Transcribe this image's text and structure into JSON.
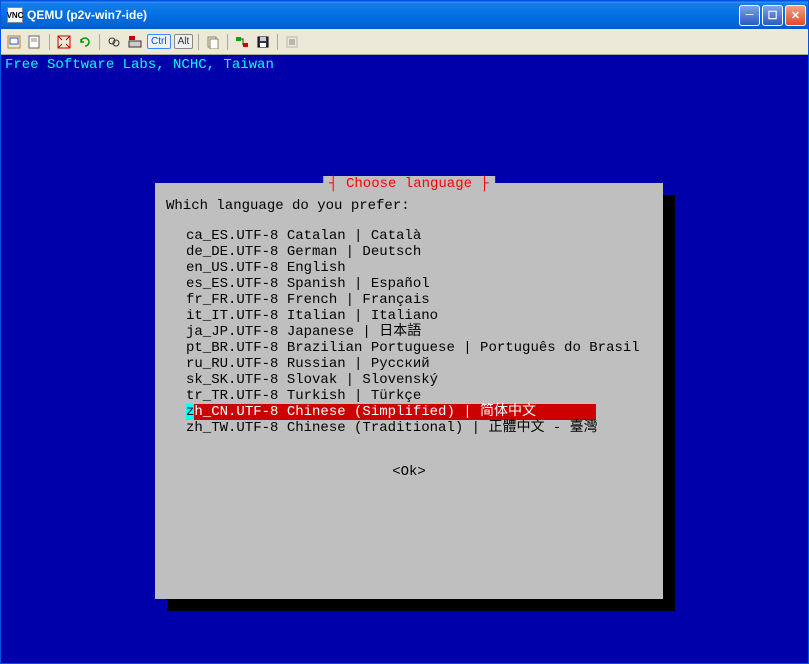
{
  "window": {
    "title": "QEMU (p2v-win7-ide)",
    "icon_text": "VNC"
  },
  "toolbar": {
    "ctrl": "Ctrl",
    "alt": "Alt"
  },
  "console": {
    "header": "Free Software Labs, NCHC, Taiwan"
  },
  "dialog": {
    "title": "Choose language",
    "prompt": "Which language do you prefer:",
    "ok": "<Ok>",
    "selected_index": 11,
    "languages": [
      "ca_ES.UTF-8 Catalan | Català",
      "de_DE.UTF-8 German | Deutsch",
      "en_US.UTF-8 English",
      "es_ES.UTF-8 Spanish | Español",
      "fr_FR.UTF-8 French | Français",
      "it_IT.UTF-8 Italian | Italiano",
      "ja_JP.UTF-8 Japanese | 日本語",
      "pt_BR.UTF-8 Brazilian Portuguese | Português do Brasil",
      "ru_RU.UTF-8 Russian | Русский",
      "sk_SK.UTF-8 Slovak | Slovenský",
      "tr_TR.UTF-8 Turkish | Türkçe",
      "zh_CN.UTF-8 Chinese (Simplified) | 简体中文",
      "zh_TW.UTF-8 Chinese (Traditional) | 正體中文 - 臺灣"
    ]
  }
}
